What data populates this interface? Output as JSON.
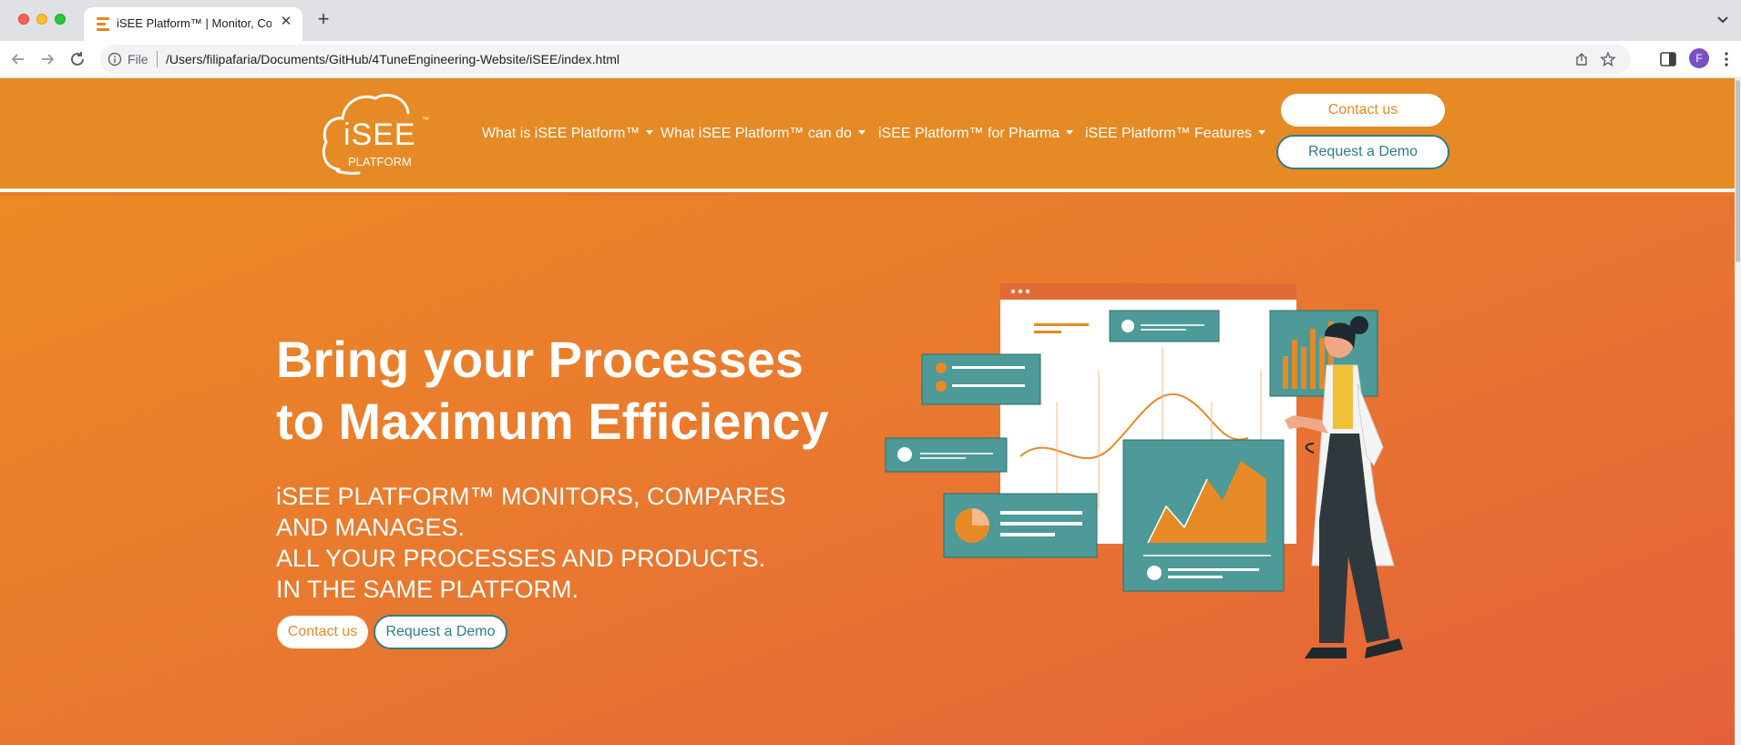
{
  "browser": {
    "tab_title": "iSEE Platform™ | Monitor, Compare",
    "omnibox_scheme": "File",
    "omnibox_url": "/Users/filipafaria/Documents/GitHub/4TuneEngineering-Website/iSEE/index.html",
    "avatar_initial": "F"
  },
  "site": {
    "logo_text": "iSEE",
    "logo_subtext": "PLATFORM",
    "logo_tm": "™",
    "nav": [
      {
        "label": "What is iSEE Platform™"
      },
      {
        "label": "What iSEE Platform™ can do"
      },
      {
        "label": "iSEE Platform™ for Pharma"
      },
      {
        "label": "iSEE Platform™ Features"
      }
    ],
    "header_contact": "Contact us",
    "header_demo": "Request a Demo"
  },
  "hero": {
    "title_line1": "Bring your Processes",
    "title_line2": "to Maximum Efficiency",
    "sub_line1": "iSEE PLATFORM™ MONITORS, COMPARES",
    "sub_line2": "AND MANAGES.",
    "sub_line3": "ALL YOUR PROCESSES AND PRODUCTS.",
    "sub_line4": "IN THE SAME PLATFORM.",
    "contact_label": "Contact us",
    "demo_label": "Request a Demo"
  },
  "colors": {
    "brand_orange": "#e68a25",
    "accent_teal": "#2e7e87",
    "card_teal": "#4d9a98",
    "coat_yellow": "#f2c13a"
  },
  "icons": [
    "tab-favicon-icon",
    "close-icon",
    "plus-icon",
    "chevron-down-icon",
    "back-icon",
    "forward-icon",
    "reload-icon",
    "info-icon",
    "share-icon",
    "star-icon",
    "side-panel-icon",
    "kebab-menu-icon"
  ]
}
